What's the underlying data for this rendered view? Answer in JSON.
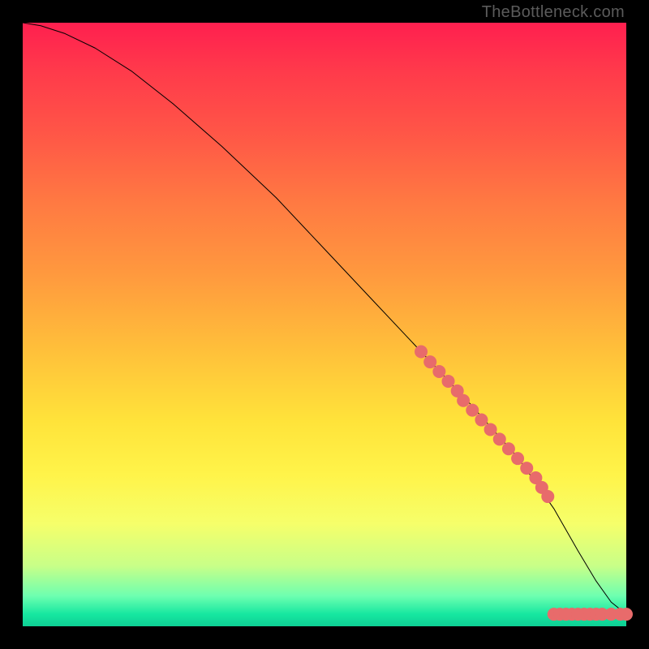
{
  "watermark": "TheBottleneck.com",
  "chart_data": {
    "type": "line",
    "title": "",
    "xlabel": "",
    "ylabel": "",
    "xlim": [
      0,
      100
    ],
    "ylim": [
      0,
      100
    ],
    "grid": false,
    "series": [
      {
        "name": "curve",
        "kind": "line",
        "x": [
          0,
          3,
          7,
          12,
          18,
          25,
          33,
          42,
          50,
          58,
          66,
          74,
          82,
          88,
          92,
          95,
          97.5,
          100
        ],
        "y": [
          100,
          99.5,
          98.2,
          95.8,
          92,
          86.5,
          79.5,
          71,
          62.5,
          54,
          45.5,
          37,
          28,
          19.5,
          12.5,
          7.5,
          4,
          2
        ],
        "stroke": "#000000",
        "stroke_width": 1
      },
      {
        "name": "highlight-points-diagonal",
        "kind": "scatter",
        "x": [
          66,
          67.5,
          69,
          70.5,
          72,
          73,
          74.5,
          76,
          77.5,
          79,
          80.5,
          82,
          83.5,
          85,
          86,
          87
        ],
        "y": [
          45.5,
          43.8,
          42.2,
          40.6,
          39,
          37.4,
          35.8,
          34.2,
          32.6,
          31,
          29.4,
          27.8,
          26.2,
          24.6,
          23,
          21.5
        ],
        "marker_color": "#e86b6b",
        "marker_size": 8
      },
      {
        "name": "highlight-points-bottom",
        "kind": "scatter",
        "x": [
          88,
          89,
          90,
          91,
          92,
          93,
          94,
          95,
          96,
          97.5,
          99,
          100
        ],
        "y": [
          2,
          2,
          2,
          2,
          2,
          2,
          2,
          2,
          2,
          2,
          2,
          2
        ],
        "marker_color": "#e86b6b",
        "marker_size": 8
      }
    ],
    "background_gradient_stops": [
      {
        "pos": 0.0,
        "color": "#ff1f4f"
      },
      {
        "pos": 0.3,
        "color": "#ff7a42"
      },
      {
        "pos": 0.55,
        "color": "#ffc23a"
      },
      {
        "pos": 0.75,
        "color": "#fff44a"
      },
      {
        "pos": 0.9,
        "color": "#c8ff88"
      },
      {
        "pos": 0.98,
        "color": "#16e7a0"
      },
      {
        "pos": 1.0,
        "color": "#0ecf94"
      }
    ]
  }
}
